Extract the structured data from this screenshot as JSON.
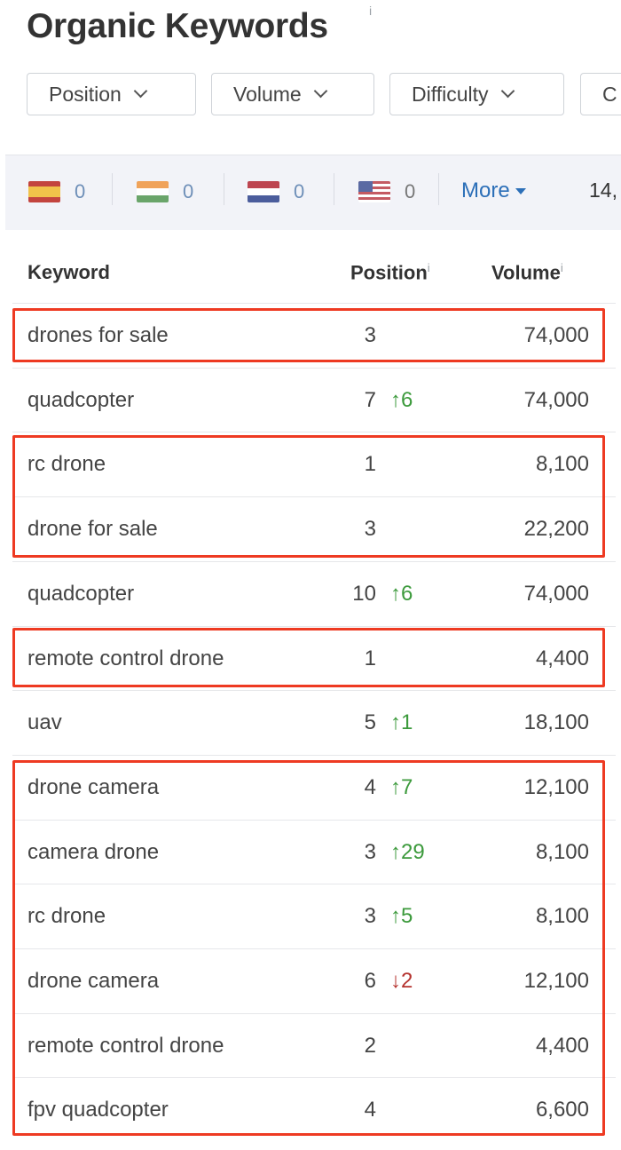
{
  "header": {
    "title": "Organic Keywords",
    "info": "i"
  },
  "filters": [
    {
      "label": "Position"
    },
    {
      "label": "Volume"
    },
    {
      "label": "Difficulty"
    },
    {
      "label": "C"
    }
  ],
  "countries": [
    {
      "flag": "spain-flag-icon",
      "count": "0"
    },
    {
      "flag": "india-flag-icon",
      "count": "0"
    },
    {
      "flag": "netherlands-flag-icon",
      "count": "0"
    },
    {
      "flag": "usa-flag-icon",
      "count": "0"
    }
  ],
  "more_label": "More",
  "trailing_count": "14,",
  "table": {
    "columns": {
      "keyword": "Keyword",
      "position": "Position",
      "volume": "Volume",
      "info": "i"
    },
    "rows": [
      {
        "keyword": "drones for sale",
        "position": "3",
        "change": "",
        "change_dir": "",
        "volume": "74,000"
      },
      {
        "keyword": "quadcopter",
        "position": "7",
        "change": "↑6",
        "change_dir": "up",
        "volume": "74,000"
      },
      {
        "keyword": "rc drone",
        "position": "1",
        "change": "",
        "change_dir": "",
        "volume": "8,100"
      },
      {
        "keyword": "drone for sale",
        "position": "3",
        "change": "",
        "change_dir": "",
        "volume": "22,200"
      },
      {
        "keyword": "quadcopter",
        "position": "10",
        "change": "↑6",
        "change_dir": "up",
        "volume": "74,000"
      },
      {
        "keyword": "remote control drone",
        "position": "1",
        "change": "",
        "change_dir": "",
        "volume": "4,400"
      },
      {
        "keyword": "uav",
        "position": "5",
        "change": "↑1",
        "change_dir": "up",
        "volume": "18,100"
      },
      {
        "keyword": "drone camera",
        "position": "4",
        "change": "↑7",
        "change_dir": "up",
        "volume": "12,100"
      },
      {
        "keyword": "camera drone",
        "position": "3",
        "change": "↑29",
        "change_dir": "up",
        "volume": "8,100"
      },
      {
        "keyword": "rc drone",
        "position": "3",
        "change": "↑5",
        "change_dir": "up",
        "volume": "8,100"
      },
      {
        "keyword": "drone camera",
        "position": "6",
        "change": "↓2",
        "change_dir": "down",
        "volume": "12,100"
      },
      {
        "keyword": "remote control drone",
        "position": "2",
        "change": "",
        "change_dir": "",
        "volume": "4,400"
      },
      {
        "keyword": "fpv quadcopter",
        "position": "4",
        "change": "",
        "change_dir": "",
        "volume": "6,600"
      }
    ]
  },
  "colors": {
    "highlight_box": "#ee3a22",
    "change_up": "#3c9a3c",
    "change_down": "#b5332f",
    "link": "#2c6fb8"
  }
}
